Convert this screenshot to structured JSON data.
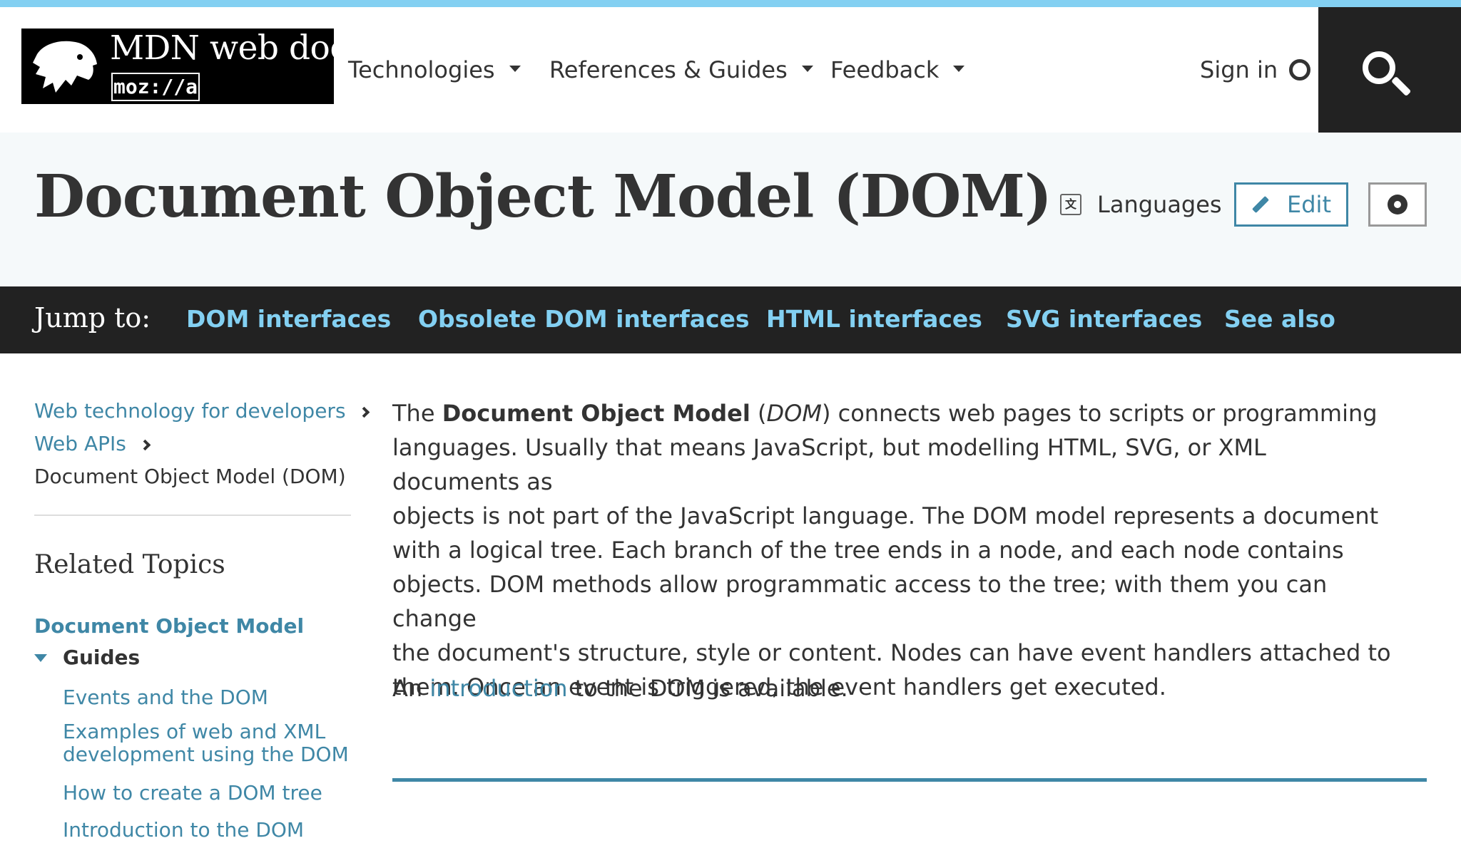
{
  "header": {
    "logo": {
      "wordmark": "MDN web docs",
      "sub": "moz://a"
    },
    "nav": [
      {
        "label": "Technologies"
      },
      {
        "label": "References & Guides"
      },
      {
        "label": "Feedback"
      }
    ],
    "signin_label": "Sign in"
  },
  "page": {
    "title": "Document Object Model (DOM)",
    "languages_label": "Languages",
    "edit_label": "Edit"
  },
  "jump": {
    "label": "Jump to:",
    "links": [
      "DOM interfaces",
      "Obsolete DOM interfaces",
      "HTML interfaces",
      "SVG interfaces",
      "See also"
    ]
  },
  "sidebar": {
    "breadcrumbs": [
      "Web technology for developers",
      "Web APIs",
      "Document Object Model (DOM)"
    ],
    "related_title": "Related Topics",
    "topic": "Document Object Model",
    "guides_label": "Guides",
    "guides": [
      "Events and the DOM",
      "Examples of web and XML",
      "development using the DOM",
      "How to create a DOM tree",
      "Introduction to the DOM"
    ]
  },
  "article": {
    "p1_lines": [
      {
        "pre": "The ",
        "bold": "Document Object Model",
        "mid": " (",
        "ital": "DOM",
        "post": ") connects web pages to scripts or programming"
      },
      "languages. Usually that means JavaScript, but modelling HTML, SVG, or XML documents as",
      "objects is not part of the JavaScript language. The DOM model represents a document",
      "with a logical tree. Each branch of the tree ends in a node, and each node contains",
      "objects. DOM methods allow programmatic access to the tree; with them you can change",
      "the document's structure, style or content. Nodes can have event handlers attached to",
      "them. Once an event is triggered, the event handlers get executed."
    ],
    "p2": {
      "pre": "An ",
      "link": "introduction",
      "post": " to the DOM is available."
    }
  },
  "colors": {
    "accent": "#3f87a6",
    "jump_link": "#83d0f2",
    "dark": "#222222",
    "stripe": "#83d0f2"
  }
}
